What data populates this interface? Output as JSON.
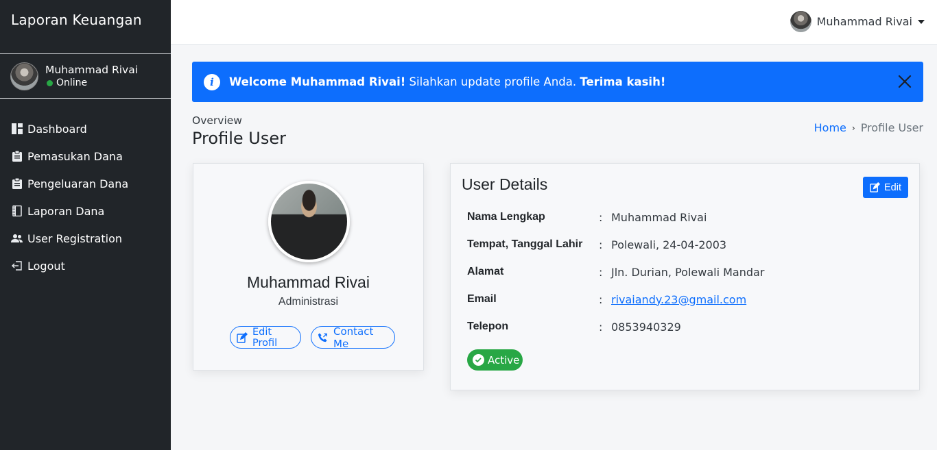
{
  "sidebar": {
    "brand": "Laporan Keuangan",
    "user": {
      "name": "Muhammad Rivai",
      "status": "Online"
    },
    "items": [
      {
        "label": "Dashboard",
        "icon": "dashboard-icon"
      },
      {
        "label": "Pemasukan Dana",
        "icon": "clipboard-icon"
      },
      {
        "label": "Pengeluaran Dana",
        "icon": "clipboard-icon"
      },
      {
        "label": "Laporan Dana",
        "icon": "journal-icon"
      },
      {
        "label": "User Registration",
        "icon": "users-icon"
      },
      {
        "label": "Logout",
        "icon": "logout-icon"
      }
    ]
  },
  "topbar": {
    "user_name": "Muhammad Rivai"
  },
  "alert": {
    "strong_welcome": "Welcome Muhammad Rivai!",
    "message": " Silahkan update profile Anda. ",
    "strong_thanks": "Terima kasih!"
  },
  "header": {
    "overview": "Overview",
    "title": "Profile User",
    "breadcrumb": {
      "home": "Home",
      "current": "Profile User"
    }
  },
  "profile": {
    "name": "Muhammad Rivai",
    "role": "Administrasi",
    "edit_label": "Edit Profil",
    "contact_label": "Contact Me"
  },
  "details": {
    "title": "User Details",
    "edit_label": "Edit",
    "rows": [
      {
        "label": "Nama Lengkap",
        "value": "Muhammad Rivai"
      },
      {
        "label": "Tempat, Tanggal Lahir",
        "value": "Polewali, 24-04-2003"
      },
      {
        "label": "Alamat",
        "value": "Jln. Durian, Polewali Mandar"
      },
      {
        "label": "Email",
        "value": "rivaiandy.23@gmail.com"
      },
      {
        "label": "Telepon",
        "value": "0853940329"
      }
    ],
    "colon": ":",
    "status": "Active"
  },
  "colors": {
    "primary": "#0d6efd",
    "sidebar_bg": "#212529",
    "success": "#28a745"
  }
}
